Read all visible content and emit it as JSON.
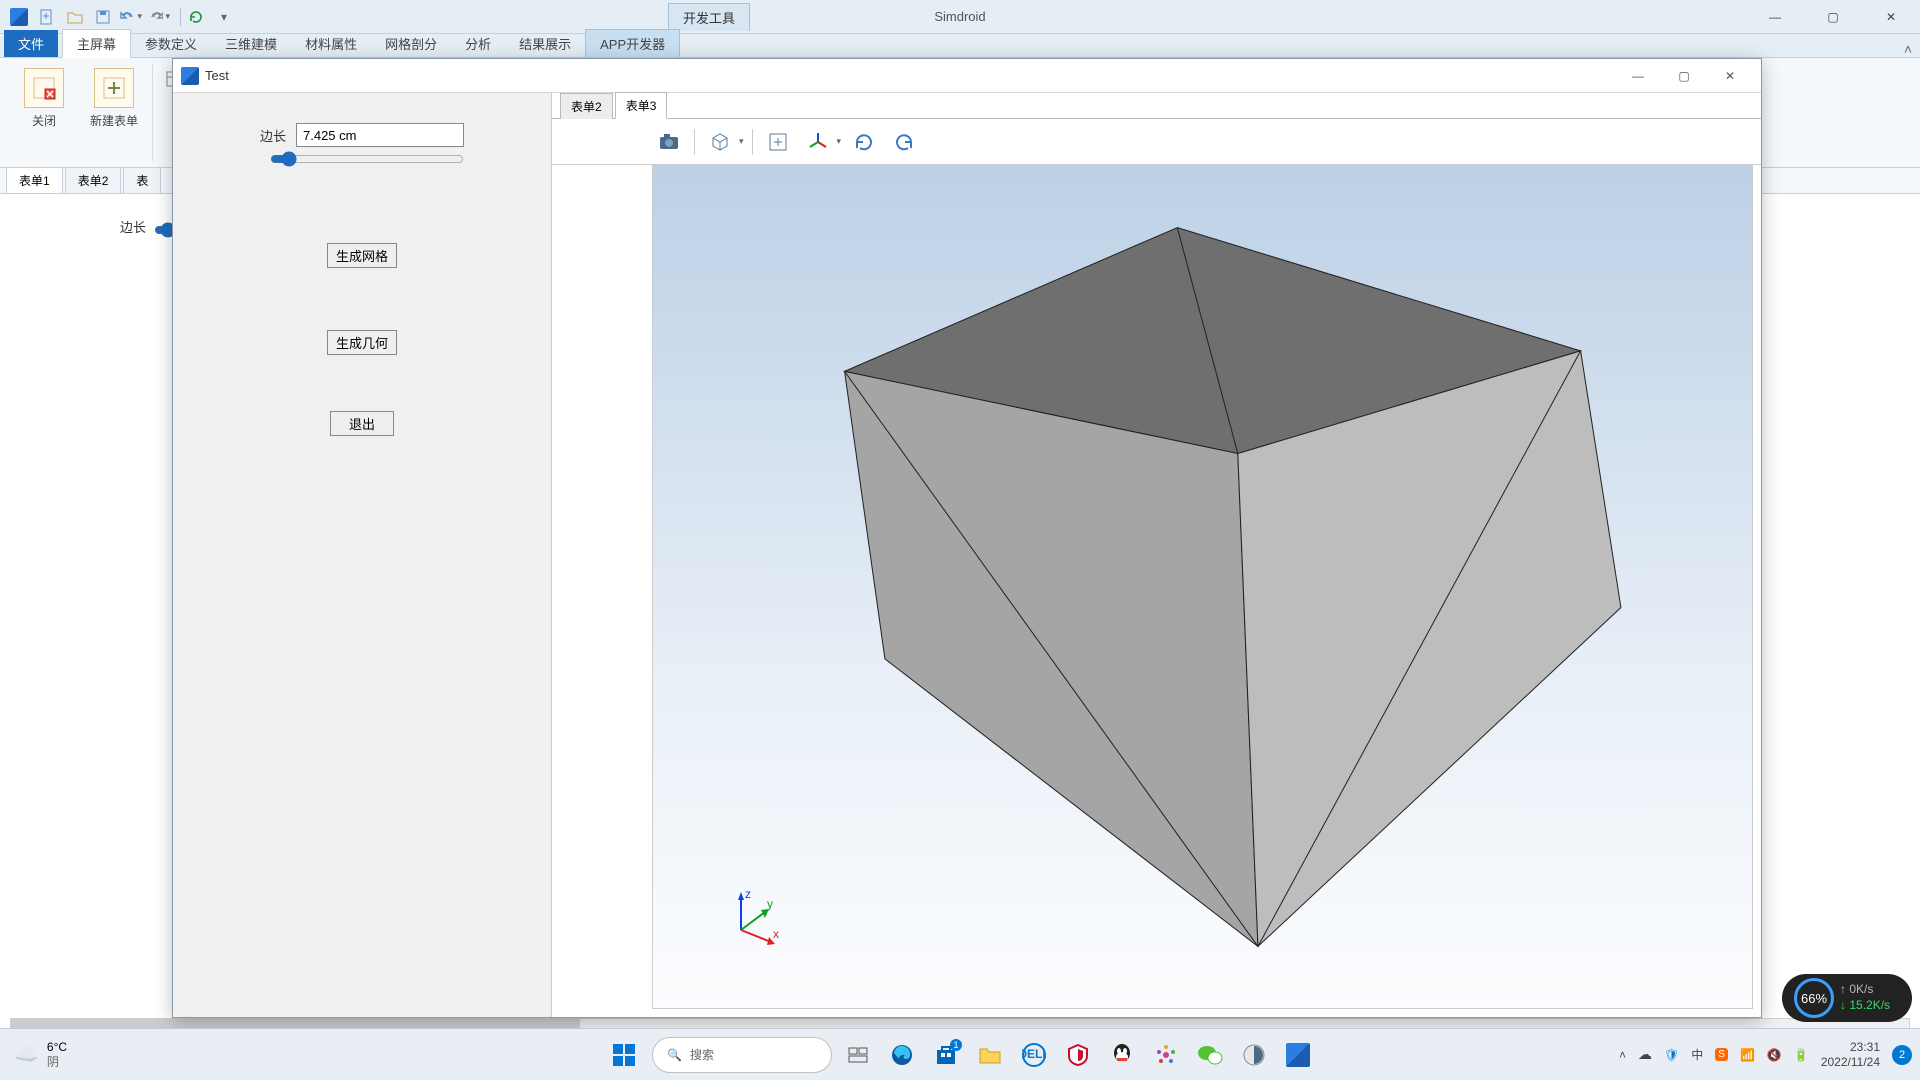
{
  "app": {
    "title": "Simdroid",
    "dev_tool_tab": "开发工具"
  },
  "qat_icons": [
    "app-logo",
    "new-doc",
    "open-doc",
    "save-doc",
    "undo",
    "redo",
    "refresh",
    "more"
  ],
  "ribbon_tabs": {
    "file": "文件",
    "items": [
      "主屏幕",
      "参数定义",
      "三维建模",
      "材料属性",
      "网格剖分",
      "分析",
      "结果展示",
      "APP开发器"
    ],
    "active_index": 0
  },
  "ribbon_buttons": {
    "close": "关闭",
    "new_form": "新建表单"
  },
  "sub_tabs": {
    "items": [
      "表单1",
      "表单2",
      "表"
    ],
    "active_index": 0
  },
  "bg_param": {
    "label": "边长"
  },
  "child": {
    "title": "Test",
    "param": {
      "label": "边长",
      "value": "7.425 cm"
    },
    "buttons": {
      "gen_mesh": "生成网格",
      "gen_geom": "生成几何",
      "exit": "退出"
    },
    "view_tabs": {
      "items": [
        "表单2",
        "表单3"
      ],
      "active_index": 1
    },
    "axis": {
      "x": "x",
      "y": "y",
      "z": "z"
    }
  },
  "net_widget": {
    "percent": "66%",
    "up": "0K/s",
    "down": "15.2K/s"
  },
  "taskbar": {
    "weather": {
      "temp": "6°C",
      "desc": "阴"
    },
    "search_placeholder": "搜索",
    "time": "23:31",
    "date": "2022/11/24",
    "notif_count": "2",
    "app_badge": "1"
  }
}
